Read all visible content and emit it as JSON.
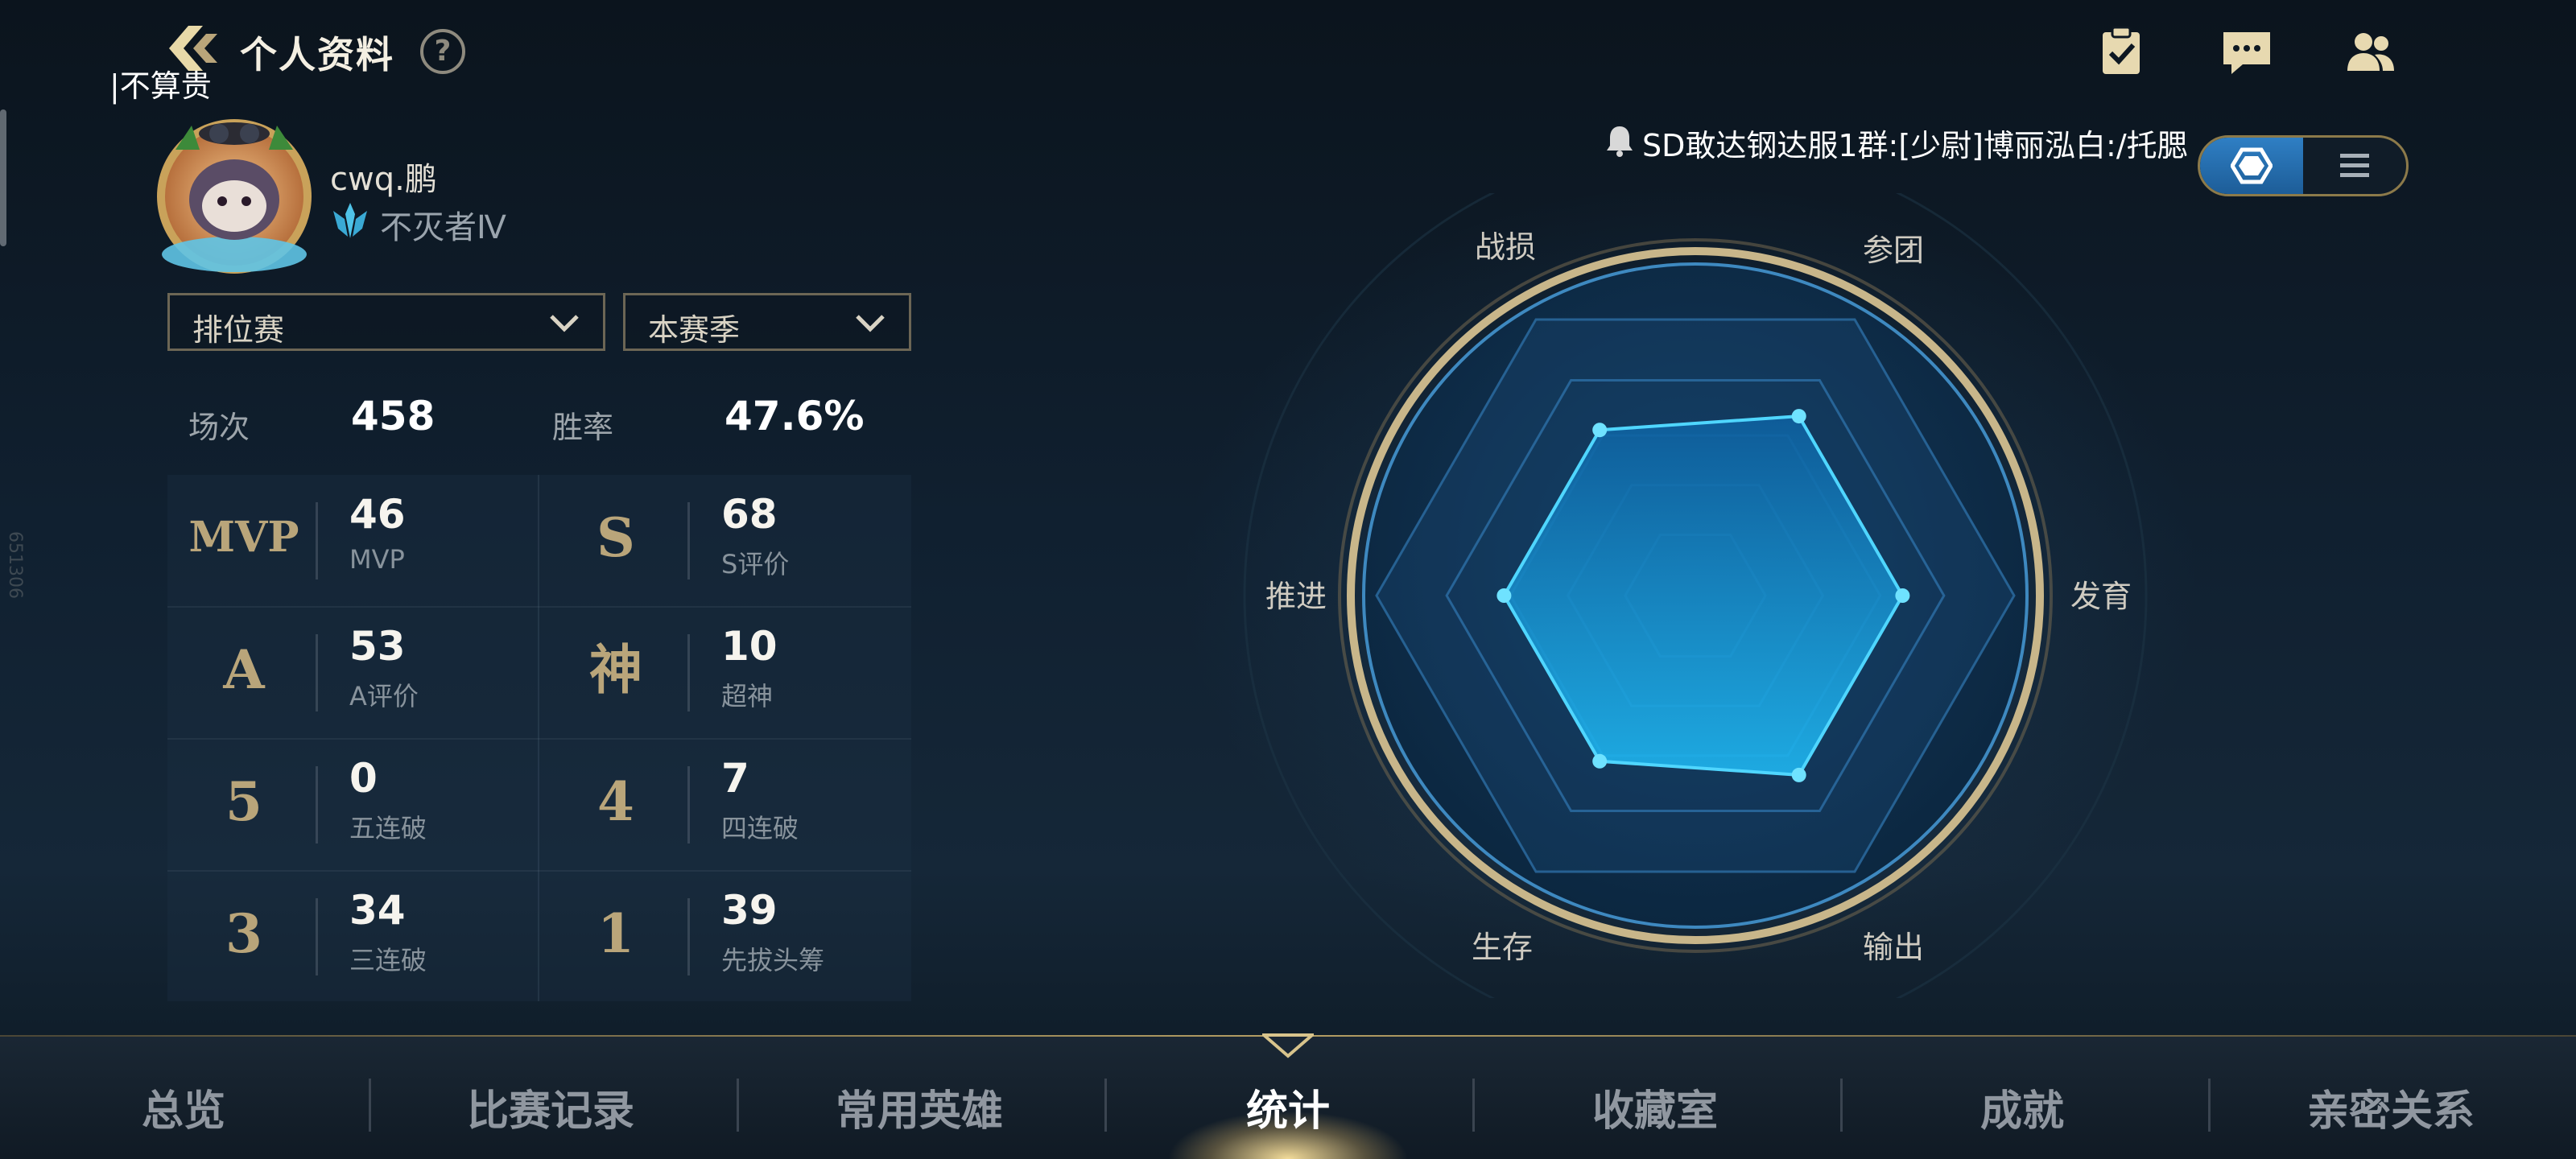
{
  "header": {
    "title": "个人资料",
    "help_label": "?",
    "overlay_user": "|不算贵"
  },
  "top_icons": [
    "task-icon",
    "chat-icon",
    "friends-icon"
  ],
  "notice": {
    "text": "SD敢达钢达服1群:[少尉]博丽泓白:/托腮"
  },
  "profile": {
    "username": "cwq.鹏",
    "rank": "不灭者Ⅳ"
  },
  "filters": {
    "mode": "排位赛",
    "season": "本赛季"
  },
  "summary": {
    "games_label": "场次",
    "games": "458",
    "winrate_label": "胜率",
    "winrate": "47.6%"
  },
  "stats": [
    {
      "badge": "MVP",
      "value": "46",
      "label": "MVP"
    },
    {
      "badge": "S",
      "value": "68",
      "label": "S评价"
    },
    {
      "badge": "A",
      "value": "53",
      "label": "A评价"
    },
    {
      "badge": "神",
      "value": "10",
      "label": "超神"
    },
    {
      "badge": "5",
      "value": "0",
      "label": "五连破"
    },
    {
      "badge": "4",
      "value": "7",
      "label": "四连破"
    },
    {
      "badge": "3",
      "value": "34",
      "label": "三连破"
    },
    {
      "badge": "1",
      "value": "39",
      "label": "先拔头筹"
    }
  ],
  "radar": {
    "axes": [
      "战损",
      "参团",
      "发育",
      "输出",
      "生存",
      "推进"
    ],
    "values": [
      0.6,
      0.65,
      0.65,
      0.65,
      0.6,
      0.6
    ]
  },
  "nav": {
    "items": [
      "总览",
      "比赛记录",
      "常用英雄",
      "统计",
      "收藏室",
      "成就",
      "亲密关系"
    ],
    "active": "统计"
  },
  "side_code": "651306",
  "colors": {
    "accent": "#b9a57a",
    "radar_fill": "#1aa6e6",
    "radar_stroke": "#4fd6ff"
  }
}
